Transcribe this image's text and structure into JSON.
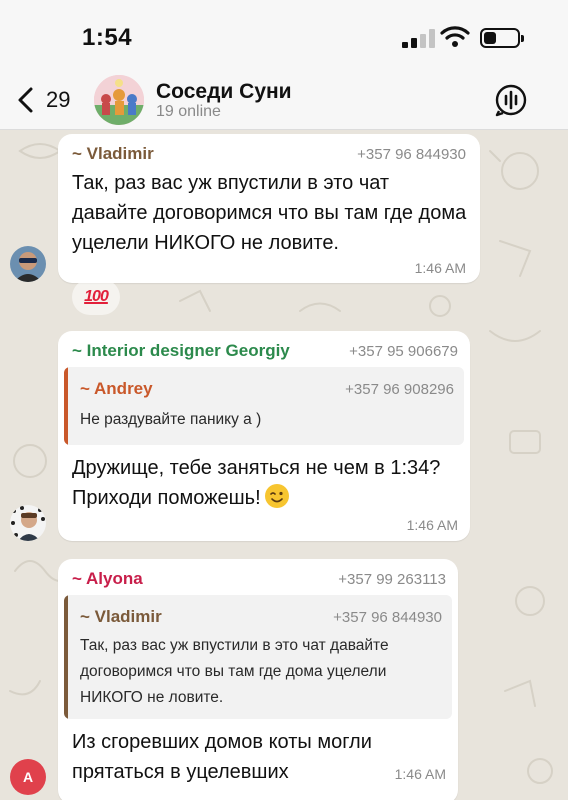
{
  "status_bar": {
    "time": "1:54"
  },
  "nav": {
    "back_count": "29",
    "title": "Соседи Суни",
    "subtitle": "19 online"
  },
  "messages": [
    {
      "sender": "~ Vladimir",
      "sender_color": "#7b5a3a",
      "phone": "+357 96 844930",
      "text": "Так, раз вас уж впустили в это чат давайте договоримся что вы там где дома уцелели НИКОГО не ловите.",
      "time": "1:46 AM",
      "reaction": "💯",
      "avatar": "person-photo"
    },
    {
      "sender": "~ Interior designer Georgiy",
      "sender_color": "#2c8a4c",
      "phone": "+357 95 906679",
      "quote": {
        "sender": "~ Andrey",
        "sender_color": "#c9582a",
        "phone": "+357 96 908296",
        "text": "Не раздувайте панику а )"
      },
      "text": "Дружище, тебе заняться не чем в 1:34? Приходи поможешь!",
      "emoji": "winking-face",
      "time": "1:46 AM",
      "avatar": "person-photo"
    },
    {
      "sender": "~ Alyona",
      "sender_color": "#c81e4a",
      "phone": "+357 99 263113",
      "quote": {
        "sender": "~ Vladimir",
        "sender_color": "#7b5a3a",
        "phone": "+357 96 844930",
        "text": "Так, раз вас уж впустили в это чат давайте договоримся что вы там где дома уцелели НИКОГО не ловите."
      },
      "text": "Из сгоревших домов коты могли прятаться в уцелевших",
      "time": "1:46 AM",
      "avatar_letter": "A",
      "avatar_color": "#e0414c"
    }
  ]
}
